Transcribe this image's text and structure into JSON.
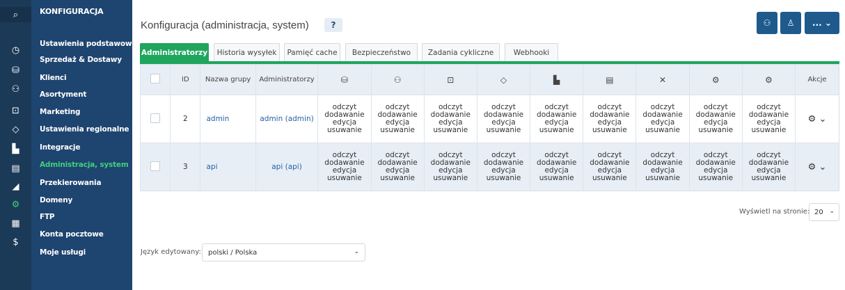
{
  "iconbar": [
    {
      "icon": "search-icon",
      "glyph": "⌕"
    },
    {
      "icon": "clock-icon",
      "glyph": "◷"
    },
    {
      "icon": "basket-icon",
      "glyph": "⛁"
    },
    {
      "icon": "users-icon",
      "glyph": "⚇"
    },
    {
      "icon": "box-icon",
      "glyph": "⊡"
    },
    {
      "icon": "tag-icon",
      "glyph": "◇"
    },
    {
      "icon": "bar-chart-icon",
      "glyph": "▙"
    },
    {
      "icon": "document-icon",
      "glyph": "▤"
    },
    {
      "icon": "graph-icon",
      "glyph": "◢"
    },
    {
      "icon": "gear-icon",
      "glyph": "⚙"
    },
    {
      "icon": "apps-grid-icon",
      "glyph": "▦"
    },
    {
      "icon": "dollar-icon",
      "glyph": "$"
    }
  ],
  "nav": {
    "title": "KONFIGURACJA",
    "items": [
      "Ustawienia podstawowe",
      "Sprzedaż & Dostawy",
      "Klienci",
      "Asortyment",
      "Marketing",
      "Ustawienia regionalne",
      "Integracje",
      "Administracja, system",
      "Przekierowania",
      "Domeny",
      "FTP",
      "Konta pocztowe",
      "Moje usługi"
    ],
    "active_index": 7
  },
  "header": {
    "title": "Konfiguracja (administracja, system)",
    "help_label": "?",
    "user_group_icon": "users-icon",
    "user_icon": "user-icon",
    "more_label": "... ⌄"
  },
  "tabs": [
    {
      "label": "Administratorzy",
      "active": true
    },
    {
      "label": "Historia wysyłek",
      "active": false
    },
    {
      "label": "Pamięć cache",
      "active": false
    },
    {
      "label": "Bezpieczeństwo",
      "active": false
    },
    {
      "label": "Zadania cykliczne",
      "active": false
    },
    {
      "label": "Webhooki",
      "active": false
    }
  ],
  "table": {
    "headers": {
      "id": "ID",
      "group": "Nazwa grupy",
      "admins": "Administratorzy",
      "actions": "Akcje"
    },
    "perm_columns": [
      {
        "icon": "basket-icon",
        "glyph": "⛁"
      },
      {
        "icon": "users-icon",
        "glyph": "⚇"
      },
      {
        "icon": "box-icon",
        "glyph": "⊡"
      },
      {
        "icon": "tag-icon",
        "glyph": "◇"
      },
      {
        "icon": "bar-chart-icon",
        "glyph": "▙"
      },
      {
        "icon": "document-icon",
        "glyph": "▤"
      },
      {
        "icon": "tools-icon",
        "glyph": "✕"
      },
      {
        "icon": "gear-icon",
        "glyph": "⚙"
      },
      {
        "icon": "gear-icon",
        "glyph": "⚙"
      }
    ],
    "perm_text": [
      "odczyt",
      "dodawanie",
      "edycja",
      "usuwanie"
    ],
    "rows": [
      {
        "id": "2",
        "group": "admin",
        "admins": "admin (admin)"
      },
      {
        "id": "3",
        "group": "api",
        "admins": "api (api)"
      }
    ],
    "action_glyph": "⚙ ⌄"
  },
  "pagination": {
    "per_page_label": "Wyświetl na stronie:",
    "per_page_value": "20"
  },
  "language": {
    "label": "Język edytowany:",
    "value": "polski / Polska"
  },
  "colors": {
    "accent_green": "#1fa55d",
    "nav_bg": "#1e4470",
    "link": "#2462a8"
  }
}
